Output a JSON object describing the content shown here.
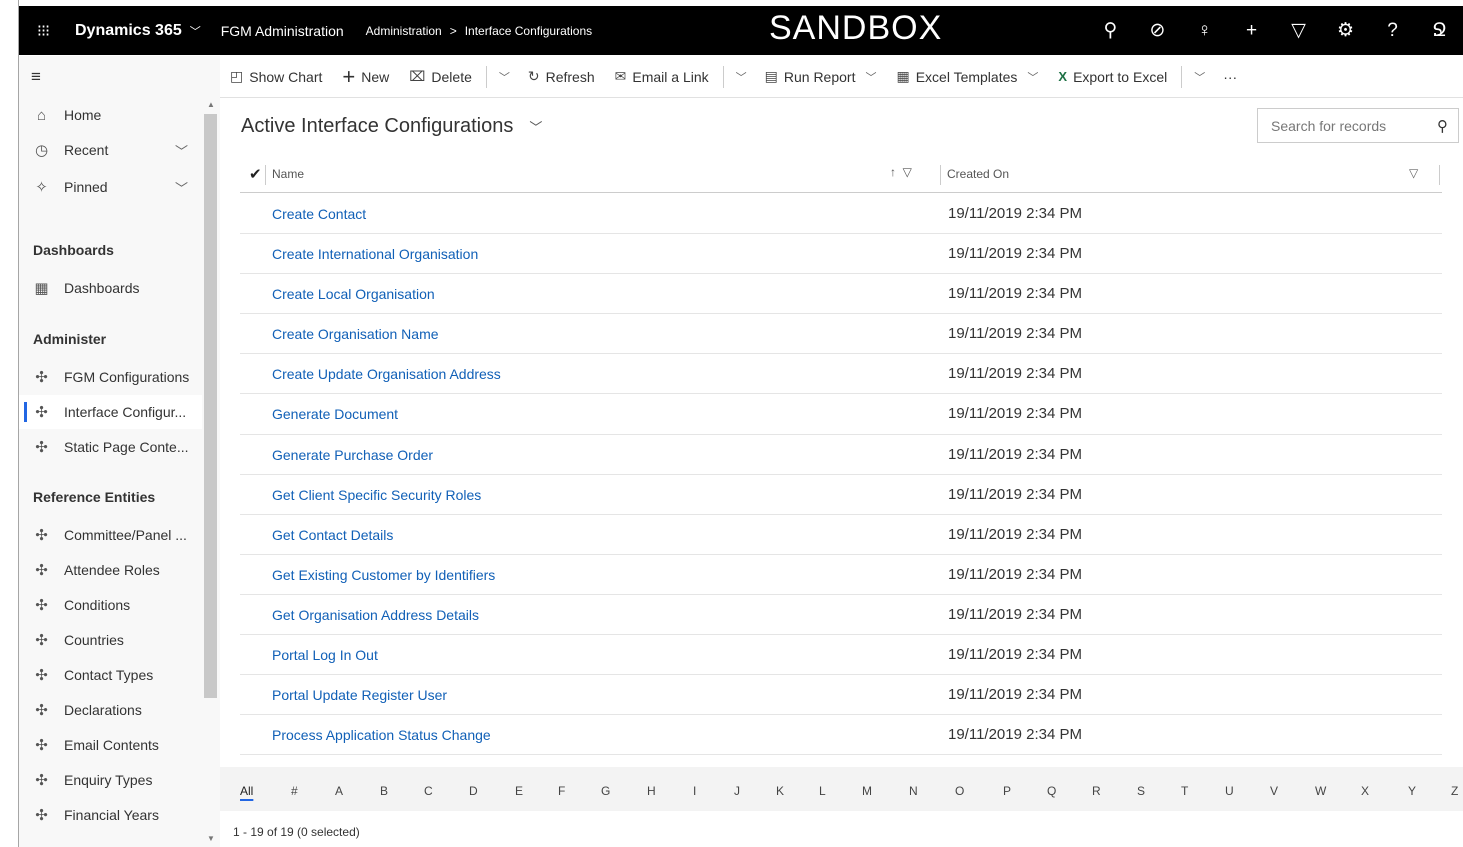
{
  "topbar": {
    "brand": "Dynamics 365",
    "app_name": "FGM Administration",
    "breadcrumb_root": "Administration",
    "breadcrumb_current": "Interface Configurations",
    "environment": "SANDBOX",
    "icons": [
      "search-icon",
      "task-icon",
      "lightbulb-icon",
      "plus-icon",
      "filter-icon",
      "gear-icon",
      "help-icon",
      "user-icon"
    ]
  },
  "commandbar": {
    "show_chart": "Show Chart",
    "new": "New",
    "delete": "Delete",
    "refresh": "Refresh",
    "email_link": "Email a Link",
    "run_report": "Run Report",
    "excel_templates": "Excel Templates",
    "export_excel": "Export to Excel",
    "more": "···"
  },
  "sidebar": {
    "home": "Home",
    "recent": "Recent",
    "pinned": "Pinned",
    "groups": [
      {
        "title": "Dashboards",
        "items": [
          "Dashboards"
        ]
      },
      {
        "title": "Administer",
        "items": [
          "FGM Configurations",
          "Interface Configur...",
          "Static Page Conte..."
        ]
      },
      {
        "title": "Reference Entities",
        "items": [
          "Committee/Panel ...",
          "Attendee Roles",
          "Conditions",
          "Countries",
          "Contact Types",
          "Declarations",
          "Email Contents",
          "Enquiry Types",
          "Financial Years"
        ]
      }
    ],
    "active_item": "Interface Configur..."
  },
  "view": {
    "title": "Active Interface Configurations",
    "search_placeholder": "Search for records",
    "col_name": "Name",
    "col_created": "Created On"
  },
  "rows": [
    {
      "name": "Create Contact",
      "created": "19/11/2019 2:34 PM"
    },
    {
      "name": "Create International Organisation",
      "created": "19/11/2019 2:34 PM"
    },
    {
      "name": "Create Local Organisation",
      "created": "19/11/2019 2:34 PM"
    },
    {
      "name": "Create Organisation Name",
      "created": "19/11/2019 2:34 PM"
    },
    {
      "name": "Create Update Organisation Address",
      "created": "19/11/2019 2:34 PM"
    },
    {
      "name": "Generate Document",
      "created": "19/11/2019 2:34 PM"
    },
    {
      "name": "Generate Purchase Order",
      "created": "19/11/2019 2:34 PM"
    },
    {
      "name": "Get Client Specific Security Roles",
      "created": "19/11/2019 2:34 PM"
    },
    {
      "name": "Get Contact Details",
      "created": "19/11/2019 2:34 PM"
    },
    {
      "name": "Get Existing Customer by Identifiers",
      "created": "19/11/2019 2:34 PM"
    },
    {
      "name": "Get Organisation Address Details",
      "created": "19/11/2019 2:34 PM"
    },
    {
      "name": "Portal Log In Out",
      "created": "19/11/2019 2:34 PM"
    },
    {
      "name": "Portal Update Register User",
      "created": "19/11/2019 2:34 PM"
    },
    {
      "name": "Process Application Status Change",
      "created": "19/11/2019 2:34 PM"
    }
  ],
  "jumpbar": [
    "All",
    "#",
    "A",
    "B",
    "C",
    "D",
    "E",
    "F",
    "G",
    "H",
    "I",
    "J",
    "K",
    "L",
    "M",
    "N",
    "O",
    "P",
    "Q",
    "R",
    "S",
    "T",
    "U",
    "V",
    "W",
    "X",
    "Y",
    "Z"
  ],
  "footer": {
    "record_count": "1 - 19 of 19 (0 selected)"
  }
}
